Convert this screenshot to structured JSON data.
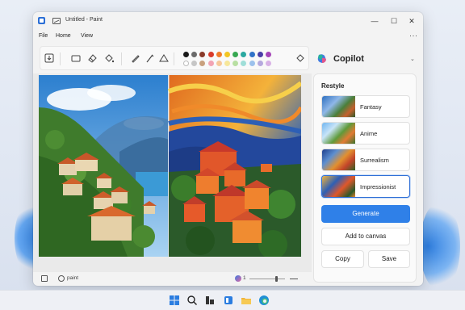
{
  "window": {
    "title": "Untitled - Paint",
    "controls": {
      "minimize": "—",
      "maximize": "☐",
      "close": "✕"
    }
  },
  "menu": {
    "items": [
      "File",
      "Home",
      "View"
    ],
    "more": "···"
  },
  "palette": {
    "row1": [
      "#1a1a1a",
      "#6b6b6b",
      "#8a3b2a",
      "#d93b2b",
      "#f07c2a",
      "#f3c623",
      "#37a852",
      "#2aa8a0",
      "#3173c8",
      "#4b3fa7",
      "#a545b8"
    ],
    "row2": [
      "#ffffff",
      "#c6c6c6",
      "#c9a17e",
      "#f2a4b4",
      "#f6c89a",
      "#f7e79a",
      "#b8dfa2",
      "#9fded8",
      "#9cc1ec",
      "#b6a9de",
      "#d8b2e6"
    ]
  },
  "statusbar": {
    "tool_label": "paint",
    "layer_count": "1",
    "zoom_level": 0.75
  },
  "copilot": {
    "title": "Copilot",
    "section": "Restyle",
    "styles": [
      {
        "name": "Fantasy",
        "selected": false
      },
      {
        "name": "Anime",
        "selected": false
      },
      {
        "name": "Surrealism",
        "selected": false
      },
      {
        "name": "Impressionist",
        "selected": true
      }
    ],
    "generate": "Generate",
    "add_to_canvas": "Add to canvas",
    "copy": "Copy",
    "save": "Save",
    "accent": "#2f80e8"
  }
}
